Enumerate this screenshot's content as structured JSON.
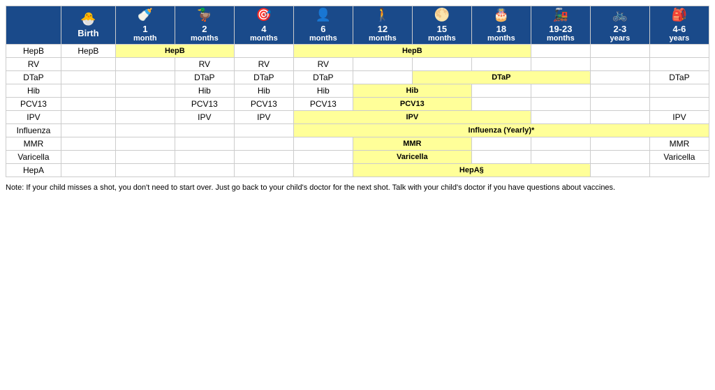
{
  "headers": [
    {
      "icon": "🐣",
      "age": "Birth",
      "unit": ""
    },
    {
      "icon": "🍼",
      "age": "1",
      "unit": "month"
    },
    {
      "icon": "🦆",
      "age": "2",
      "unit": "months"
    },
    {
      "icon": "🎯",
      "age": "4",
      "unit": "months"
    },
    {
      "icon": "👤",
      "age": "6",
      "unit": "months"
    },
    {
      "icon": "🚶",
      "age": "12",
      "unit": "months"
    },
    {
      "icon": "🌕",
      "age": "15",
      "unit": "months"
    },
    {
      "icon": "🎂",
      "age": "18",
      "unit": "months"
    },
    {
      "icon": "🚂",
      "age": "19-23",
      "unit": "months"
    },
    {
      "icon": "🚲",
      "age": "2-3",
      "unit": "years"
    },
    {
      "icon": "🎒",
      "age": "4-6",
      "unit": "years"
    }
  ],
  "vaccines": [
    {
      "name": "HepB",
      "cells": [
        {
          "col": 0,
          "label": "HepB",
          "yellow": false
        },
        {
          "col": 1,
          "span": 2,
          "label": "HepB",
          "yellow": true
        },
        {
          "col": 4,
          "span": 4,
          "label": "HepB",
          "yellow": true
        }
      ]
    },
    {
      "name": "RV",
      "cells": [
        {
          "col": 2,
          "label": "RV",
          "yellow": false
        },
        {
          "col": 3,
          "label": "RV",
          "yellow": false
        },
        {
          "col": 4,
          "label": "RV",
          "yellow": false
        }
      ]
    },
    {
      "name": "DTaP",
      "cells": [
        {
          "col": 2,
          "label": "DTaP",
          "yellow": false
        },
        {
          "col": 3,
          "label": "DTaP",
          "yellow": false
        },
        {
          "col": 4,
          "label": "DTaP",
          "yellow": false
        },
        {
          "col": 6,
          "span": 3,
          "label": "DTaP",
          "yellow": true
        },
        {
          "col": 10,
          "label": "DTaP",
          "yellow": false
        }
      ]
    },
    {
      "name": "Hib",
      "cells": [
        {
          "col": 2,
          "label": "Hib",
          "yellow": false
        },
        {
          "col": 3,
          "label": "Hib",
          "yellow": false
        },
        {
          "col": 4,
          "label": "Hib",
          "yellow": false
        },
        {
          "col": 5,
          "span": 2,
          "label": "Hib",
          "yellow": true
        }
      ]
    },
    {
      "name": "PCV13",
      "cells": [
        {
          "col": 2,
          "label": "PCV13",
          "yellow": false
        },
        {
          "col": 3,
          "label": "PCV13",
          "yellow": false
        },
        {
          "col": 4,
          "label": "PCV13",
          "yellow": false
        },
        {
          "col": 5,
          "span": 2,
          "label": "PCV13",
          "yellow": true
        }
      ]
    },
    {
      "name": "IPV",
      "cells": [
        {
          "col": 2,
          "label": "IPV",
          "yellow": false
        },
        {
          "col": 3,
          "label": "IPV",
          "yellow": false
        },
        {
          "col": 4,
          "span": 4,
          "label": "IPV",
          "yellow": true
        },
        {
          "col": 10,
          "label": "IPV",
          "yellow": false
        }
      ]
    },
    {
      "name": "Influenza",
      "cells": [
        {
          "col": 4,
          "span": 7,
          "label": "Influenza (Yearly)*",
          "yellow": true
        }
      ]
    },
    {
      "name": "MMR",
      "cells": [
        {
          "col": 5,
          "span": 2,
          "label": "MMR",
          "yellow": true
        },
        {
          "col": 10,
          "label": "MMR",
          "yellow": false
        }
      ]
    },
    {
      "name": "Varicella",
      "cells": [
        {
          "col": 5,
          "span": 2,
          "label": "Varicella",
          "yellow": true
        },
        {
          "col": 10,
          "label": "Varicella",
          "yellow": false
        }
      ]
    },
    {
      "name": "HepA",
      "cells": [
        {
          "col": 5,
          "span": 4,
          "label": "HepA§",
          "yellow": true
        }
      ]
    }
  ],
  "note": "Note: If your child misses a shot, you don't need to start over. Just go back to your child's doctor for the next shot. Talk with your child's doctor if you have questions about vaccines."
}
